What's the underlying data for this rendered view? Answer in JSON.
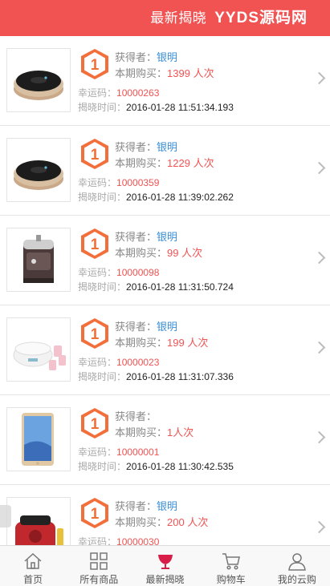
{
  "header": {
    "title": "最新揭晓",
    "brand": "YYDS源码网"
  },
  "labels": {
    "winner": "获得者：",
    "purchase": "本期购买：",
    "unit": "人次",
    "lucky_code": "幸运码：",
    "reveal_time": "揭晓时间："
  },
  "records": [
    {
      "period": "1",
      "winner": "银明",
      "count": "1399",
      "lucky_code": "10000263",
      "time": "2016-01-28 11:51:34.193",
      "product": "robot-vacuum"
    },
    {
      "period": "1",
      "winner": "银明",
      "count": "1229",
      "lucky_code": "10000359",
      "time": "2016-01-28 11:39:02.262",
      "product": "robot-vacuum"
    },
    {
      "period": "1",
      "winner": "银明",
      "count": "99",
      "lucky_code": "10000098",
      "time": "2016-01-28 11:31:50.724",
      "product": "lunch-box"
    },
    {
      "period": "1",
      "winner": "银明",
      "count": "199",
      "lucky_code": "10000023",
      "time": "2016-01-28 11:31:07.336",
      "product": "yogurt-maker"
    },
    {
      "period": "1",
      "winner": "",
      "count": "1",
      "lucky_code": "10000001",
      "time": "2016-01-28 11:30:42.535",
      "product": "tablet"
    },
    {
      "period": "1",
      "winner": "银明",
      "count": "200",
      "lucky_code": "10000030",
      "time": "",
      "product": "coffee-machine"
    }
  ],
  "tabs": [
    {
      "label": "首页",
      "icon": "home-icon"
    },
    {
      "label": "所有商品",
      "icon": "grid-icon"
    },
    {
      "label": "最新揭晓",
      "icon": "cup-icon"
    },
    {
      "label": "购物车",
      "icon": "cart-icon"
    },
    {
      "label": "我的云购",
      "icon": "user-icon"
    }
  ],
  "colors": {
    "accent": "#f15353",
    "badge": "#f26e3a",
    "name": "#3a8fd6"
  }
}
